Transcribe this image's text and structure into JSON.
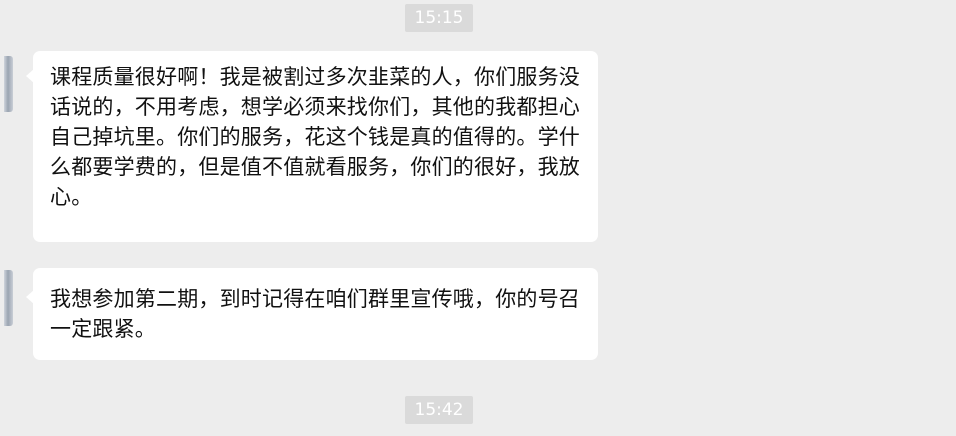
{
  "timestamps": {
    "first": "15:15",
    "second": "15:42"
  },
  "messages": [
    {
      "text": "课程质量很好啊！我是被割过多次韭菜的人，你们服务没话说的，不用考虑，想学必须来找你们，其他的我都担心自己掉坑里。你们的服务，花这个钱是真的值得的。学什么都要学费的，但是值不值就看服务，你们的很好，我放心。"
    },
    {
      "text": "我想参加第二期，到时记得在咱们群里宣传哦，你的号召一定跟紧。"
    }
  ]
}
